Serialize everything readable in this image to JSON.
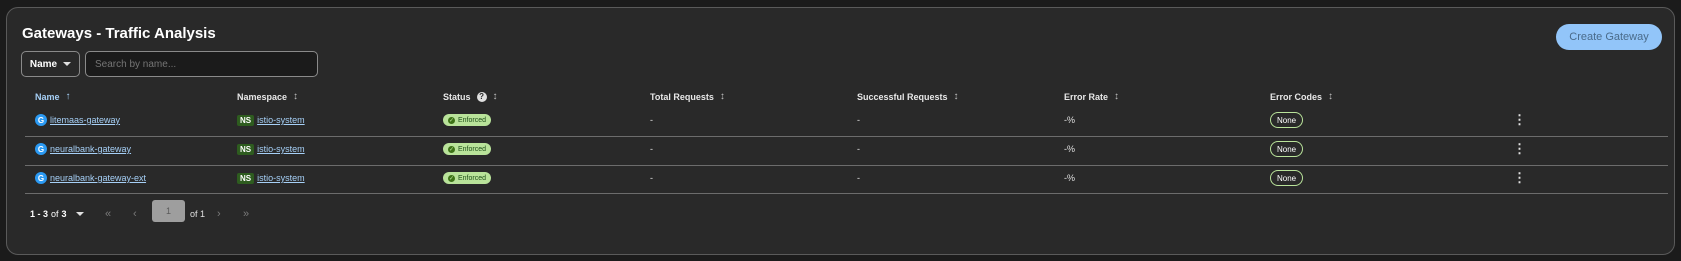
{
  "header": {
    "title": "Gateways - Traffic Analysis",
    "create_button": "Create Gateway"
  },
  "toolbar": {
    "filter_attribute": "Name",
    "search_placeholder": "Search by name..."
  },
  "columns": [
    {
      "label": "Name",
      "sort": "↑"
    },
    {
      "label": "Namespace",
      "sort": "↕"
    },
    {
      "label": "Status",
      "sort": "↕"
    },
    {
      "label": "Total Requests",
      "sort": "↕"
    },
    {
      "label": "Successful Requests",
      "sort": "↕"
    },
    {
      "label": "Error Rate",
      "sort": "↕"
    },
    {
      "label": "Error Codes",
      "sort": "↕"
    }
  ],
  "icons": {
    "gateway_badge": "G",
    "namespace_badge": "NS",
    "help": "?",
    "check": "✓",
    "kebab": "⋮"
  },
  "rows": [
    {
      "name": "litemaas-gateway",
      "namespace": "istio-system",
      "status": "Enforced",
      "total_requests": "-",
      "successful_requests": "-",
      "error_rate": "-%",
      "error_codes": "None"
    },
    {
      "name": "neuralbank-gateway",
      "namespace": "istio-system",
      "status": "Enforced",
      "total_requests": "-",
      "successful_requests": "-",
      "error_rate": "-%",
      "error_codes": "None"
    },
    {
      "name": "neuralbank-gateway-ext",
      "namespace": "istio-system",
      "status": "Enforced",
      "total_requests": "-",
      "successful_requests": "-",
      "error_rate": "-%",
      "error_codes": "None"
    }
  ],
  "pagination": {
    "range": "1 - 3",
    "of_label": "of",
    "total": "3",
    "current_page": "1",
    "of_pages": "of 1",
    "first": "«",
    "prev": "‹",
    "next": "›",
    "last": "»"
  },
  "colors": {
    "background": "#1b1b1b",
    "card": "#292929",
    "accent": "#92c5f9",
    "link": "#a6d0f7",
    "status_bg": "#b9e39a",
    "namespace_badge": "#2e5c1f",
    "gateway_icon": "#2b9af3"
  }
}
